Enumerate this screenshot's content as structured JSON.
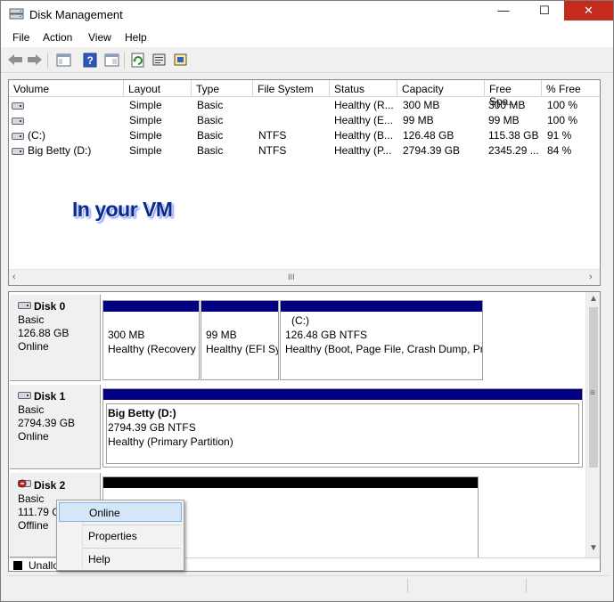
{
  "window": {
    "title": "Disk Management",
    "controls": {
      "minimize": "—",
      "maximize": "☐",
      "close": "✕"
    }
  },
  "menu": [
    "File",
    "Action",
    "View",
    "Help"
  ],
  "volume_list": {
    "columns": [
      "Volume",
      "Layout",
      "Type",
      "File System",
      "Status",
      "Capacity",
      "Free Spa...",
      "% Free"
    ],
    "rows": [
      {
        "volume": "",
        "layout": "Simple",
        "type": "Basic",
        "fs": "",
        "status": "Healthy (R...",
        "capacity": "300 MB",
        "free": "300 MB",
        "pct": "100 %"
      },
      {
        "volume": "",
        "layout": "Simple",
        "type": "Basic",
        "fs": "",
        "status": "Healthy (E...",
        "capacity": "99 MB",
        "free": "99 MB",
        "pct": "100 %"
      },
      {
        "volume": "(C:)",
        "layout": "Simple",
        "type": "Basic",
        "fs": "NTFS",
        "status": "Healthy (B...",
        "capacity": "126.48 GB",
        "free": "115.38 GB",
        "pct": "91 %"
      },
      {
        "volume": "Big Betty (D:)",
        "layout": "Simple",
        "type": "Basic",
        "fs": "NTFS",
        "status": "Healthy (P...",
        "capacity": "2794.39 GB",
        "free": "2345.29 ...",
        "pct": "84 %"
      }
    ],
    "scroll_grip": "III"
  },
  "overlay_caption": "In your VM",
  "disks": [
    {
      "name": "Disk 0",
      "type": "Basic",
      "size": "126.88 GB",
      "state": "Online",
      "partitions": [
        {
          "title": "",
          "line1": "300 MB",
          "line2": "Healthy (Recovery Partition)"
        },
        {
          "title": "",
          "line1": "99 MB",
          "line2": "Healthy (EFI System Partition)"
        },
        {
          "title": "(C:)",
          "line1": "126.48 GB NTFS",
          "line2": "Healthy (Boot, Page File, Crash Dump, Primary Partition)"
        }
      ]
    },
    {
      "name": "Disk 1",
      "type": "Basic",
      "size": "2794.39 GB",
      "state": "Online",
      "partitions": [
        {
          "title": "Big Betty  (D:)",
          "line1": "2794.39 GB NTFS",
          "line2": "Healthy (Primary Partition)"
        }
      ]
    },
    {
      "name": "Disk 2",
      "type": "Basic",
      "size": "111.79 G",
      "state": "Offline"
    }
  ],
  "legend": {
    "unallocated": "Unallo"
  },
  "context_menu": {
    "items": [
      "Online",
      "Properties",
      "Help"
    ],
    "highlighted": "Online"
  },
  "colors": {
    "partition_bar": "#000080",
    "unallocated_bar": "#000000",
    "highlight": "#d5e6f7",
    "overlay_text": "#0a2a8c"
  },
  "icons": [
    "back-arrow-icon",
    "forward-arrow-icon",
    "console-tree-icon",
    "help-icon",
    "show-pane-icon",
    "refresh-icon",
    "properties-icon",
    "rescan-icon",
    "disk-icon"
  ]
}
